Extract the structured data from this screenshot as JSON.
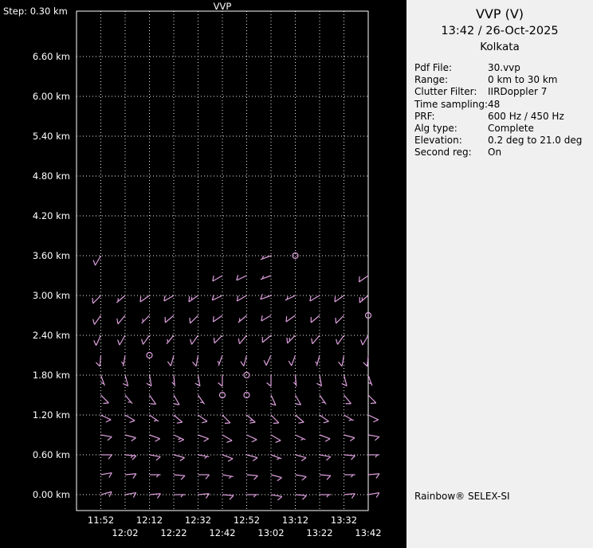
{
  "window": {
    "bg_left": "#000000",
    "bg_right": "#f0f0f0",
    "text_on_dark": "#ffffff",
    "text_on_light": "#000000"
  },
  "chart": {
    "step_label": "Step: 0.30 km",
    "title": "VVP"
  },
  "panel": {
    "title": "VVP (V)",
    "datetime": "13:42 / 26-Oct-2025",
    "site": "Kolkata",
    "fields": [
      {
        "label": "Pdf File:",
        "value": "30.vvp"
      },
      {
        "label": "Range:",
        "value": "0 km to 30 km"
      },
      {
        "label": "Clutter Filter:",
        "value": "IIRDoppler 7"
      },
      {
        "label": "Time sampling:",
        "value": "48"
      },
      {
        "label": "PRF:",
        "value": "600 Hz / 450 Hz"
      },
      {
        "label": "Alg type:",
        "value": "Complete"
      },
      {
        "label": "Elevation:",
        "value": "0.2 deg to 21.0 deg"
      },
      {
        "label": "Second reg:",
        "value": "On"
      }
    ],
    "footer": "Rainbow® SELEX-SI"
  },
  "chart_data": {
    "type": "wind-barb-profile",
    "title": "VVP",
    "x_axis": "time",
    "y_axis": "height (km)",
    "step_km": 0.3,
    "grid": "dotted",
    "grid_color": "#e8e8e8",
    "barb_color": "#dda0dd",
    "x_tick_labels": [
      "11:52",
      "12:02",
      "12:12",
      "12:22",
      "12:32",
      "12:42",
      "12:52",
      "13:02",
      "13:12",
      "13:22",
      "13:32",
      "13:42"
    ],
    "y_tick_labels": [
      "6.60 km",
      "6.00 km",
      "5.40 km",
      "4.80 km",
      "4.20 km",
      "3.60 km",
      "3.00 km",
      "2.40 km",
      "1.80 km",
      "1.20 km",
      "0.60 km",
      "0.00 km"
    ],
    "y_ticks_km": [
      6.6,
      6.0,
      5.4,
      4.8,
      4.2,
      3.6,
      3.0,
      2.4,
      1.8,
      1.2,
      0.6,
      0.0
    ],
    "ylim_km": [
      0.0,
      7.2
    ],
    "note": "spd_kt 0 = calm (circle); null = no data at that time/height",
    "rows": [
      {
        "h_km": 3.6,
        "dir_deg": [
          210,
          null,
          null,
          null,
          null,
          null,
          null,
          250,
          0,
          null,
          null,
          null
        ],
        "spd_kt": [
          10,
          null,
          null,
          null,
          null,
          null,
          null,
          5,
          0,
          null,
          null,
          null
        ]
      },
      {
        "h_km": 3.3,
        "dir_deg": [
          null,
          null,
          null,
          null,
          null,
          240,
          245,
          250,
          null,
          null,
          null,
          235
        ],
        "spd_kt": [
          null,
          null,
          null,
          null,
          null,
          10,
          10,
          5,
          null,
          null,
          null,
          10
        ]
      },
      {
        "h_km": 3.0,
        "dir_deg": [
          225,
          230,
          235,
          240,
          235,
          245,
          240,
          250,
          245,
          240,
          235,
          230
        ],
        "spd_kt": [
          10,
          5,
          10,
          10,
          15,
          10,
          10,
          10,
          5,
          10,
          10,
          15
        ]
      },
      {
        "h_km": 2.7,
        "dir_deg": [
          215,
          220,
          225,
          230,
          225,
          235,
          230,
          240,
          235,
          230,
          225,
          0
        ],
        "spd_kt": [
          10,
          10,
          5,
          10,
          10,
          10,
          5,
          10,
          10,
          10,
          10,
          0
        ]
      },
      {
        "h_km": 2.4,
        "dir_deg": [
          205,
          210,
          215,
          220,
          215,
          225,
          220,
          230,
          225,
          220,
          215,
          210
        ],
        "spd_kt": [
          10,
          10,
          10,
          5,
          10,
          10,
          10,
          10,
          15,
          10,
          10,
          10
        ]
      },
      {
        "h_km": 2.1,
        "dir_deg": [
          185,
          190,
          0,
          195,
          190,
          200,
          195,
          205,
          200,
          195,
          190,
          185
        ],
        "spd_kt": [
          10,
          5,
          0,
          10,
          10,
          5,
          10,
          10,
          10,
          5,
          10,
          10
        ]
      },
      {
        "h_km": 1.8,
        "dir_deg": [
          160,
          165,
          170,
          175,
          170,
          180,
          0,
          180,
          175,
          170,
          165,
          160
        ],
        "spd_kt": [
          5,
          10,
          10,
          5,
          10,
          10,
          0,
          10,
          5,
          10,
          10,
          5
        ]
      },
      {
        "h_km": 1.5,
        "dir_deg": [
          135,
          140,
          145,
          150,
          145,
          0,
          0,
          155,
          150,
          145,
          140,
          135
        ],
        "spd_kt": [
          10,
          5,
          10,
          10,
          5,
          0,
          0,
          10,
          10,
          5,
          10,
          10
        ]
      },
      {
        "h_km": 1.2,
        "dir_deg": [
          115,
          120,
          125,
          130,
          125,
          135,
          130,
          135,
          130,
          125,
          120,
          115
        ],
        "spd_kt": [
          10,
          10,
          5,
          10,
          10,
          10,
          15,
          10,
          10,
          10,
          5,
          10
        ]
      },
      {
        "h_km": 0.9,
        "dir_deg": [
          100,
          105,
          110,
          115,
          110,
          120,
          115,
          120,
          115,
          110,
          105,
          100
        ],
        "spd_kt": [
          10,
          10,
          10,
          15,
          10,
          10,
          10,
          10,
          5,
          10,
          10,
          10
        ]
      },
      {
        "h_km": 0.6,
        "dir_deg": [
          90,
          95,
          100,
          105,
          100,
          110,
          105,
          110,
          105,
          100,
          95,
          90
        ],
        "spd_kt": [
          10,
          15,
          10,
          10,
          5,
          10,
          10,
          5,
          10,
          10,
          10,
          5
        ]
      },
      {
        "h_km": 0.3,
        "dir_deg": [
          80,
          85,
          90,
          95,
          90,
          100,
          95,
          105,
          100,
          95,
          90,
          85
        ],
        "spd_kt": [
          10,
          10,
          5,
          10,
          10,
          5,
          10,
          10,
          10,
          10,
          5,
          10
        ]
      },
      {
        "h_km": 0.0,
        "dir_deg": [
          75,
          80,
          85,
          90,
          85,
          95,
          90,
          100,
          95,
          90,
          85,
          80
        ],
        "spd_kt": [
          10,
          10,
          10,
          5,
          10,
          10,
          5,
          10,
          10,
          5,
          10,
          10
        ]
      }
    ]
  }
}
